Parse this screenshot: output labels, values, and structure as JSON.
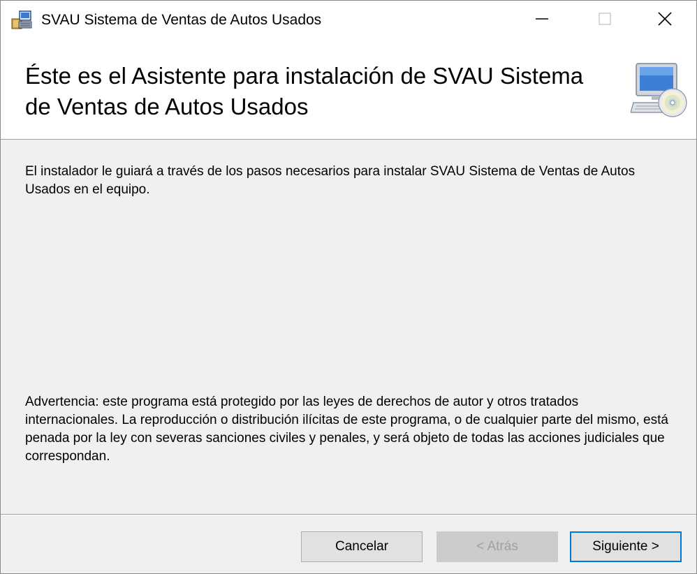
{
  "window": {
    "title": "SVAU Sistema de Ventas de Autos Usados",
    "app_icon": "installer-package-icon",
    "controls": {
      "minimize_icon": "minimize-icon",
      "maximize_icon": "maximize-icon",
      "close_icon": "close-icon"
    }
  },
  "banner": {
    "title": "Éste es el Asistente para instalación de SVAU Sistema de Ventas de Autos Usados",
    "icon": "computer-cd-icon"
  },
  "content": {
    "intro": "El instalador le guiará a través de los pasos necesarios para instalar SVAU Sistema de Ventas de Autos Usados en el equipo.",
    "warning": "Advertencia: este programa está protegido por las leyes de derechos de autor y otros tratados internacionales. La reproducción o distribución ilícitas de este programa, o de cualquier parte del mismo, está penada por la ley con severas sanciones civiles y penales, y será objeto de todas las acciones judiciales que correspondan."
  },
  "footer": {
    "cancel_label": "Cancelar",
    "back_label": "< Atrás",
    "next_label": "Siguiente >",
    "back_enabled": false
  },
  "colors": {
    "focus_border": "#0078d7",
    "disabled_text": "#a0a0a0"
  }
}
